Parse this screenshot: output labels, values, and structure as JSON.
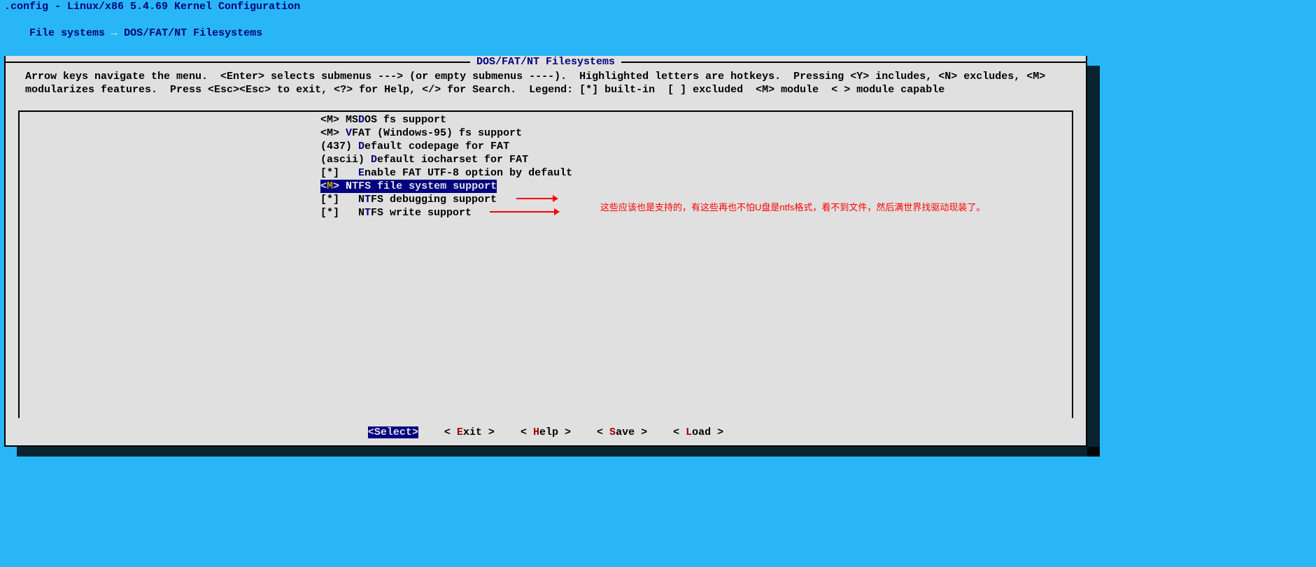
{
  "title": ".config - Linux/x86 5.4.69 Kernel Configuration",
  "breadcrumb": {
    "a": "File systems",
    "sep": " → ",
    "b": "DOS/FAT/NT Filesystems"
  },
  "panel_title": "DOS/FAT/NT Filesystems",
  "help_text": "Arrow keys navigate the menu.  <Enter> selects submenus ---> (or empty submenus ----).  Highlighted letters are hotkeys.  Pressing <Y> includes, <N> excludes, <M> modularizes features.  Press <Esc><Esc> to exit, <?> for Help, </> for Search.  Legend: [*] built-in  [ ] excluded  <M> module  < > module capable",
  "items": [
    {
      "prefix": "<M> MS",
      "hot": "D",
      "rest": "OS fs support",
      "selected": false,
      "indent": ""
    },
    {
      "prefix": "<M> ",
      "hot": "V",
      "rest": "FAT (Windows-95) fs support",
      "selected": false,
      "indent": ""
    },
    {
      "prefix": "(437) ",
      "hot": "D",
      "rest": "efault codepage for FAT",
      "selected": false,
      "indent": ""
    },
    {
      "prefix": "(ascii) ",
      "hot": "D",
      "rest": "efault iocharset for FAT",
      "selected": false,
      "indent": ""
    },
    {
      "prefix": "[*]   ",
      "hot": "E",
      "rest": "nable FAT UTF-8 option by default",
      "selected": false,
      "indent": ""
    },
    {
      "prefix": "<",
      "hot_inline": "M",
      "prefix2": "> ",
      "hot": "N",
      "rest": "TFS file system support",
      "selected": true,
      "indent": ""
    },
    {
      "prefix": "[*]   N",
      "hot": "T",
      "rest": "FS debugging support",
      "selected": false,
      "indent": ""
    },
    {
      "prefix": "[*]   N",
      "hot": "T",
      "rest": "FS write support",
      "selected": false,
      "indent": ""
    }
  ],
  "buttons": {
    "select": "Select",
    "exit": "xit",
    "exit_hot": "E",
    "help": "elp",
    "help_hot": "H",
    "save": "ave",
    "save_hot": "S",
    "load": "oad",
    "load_hot": "L"
  },
  "annotation": "这些应该也是支持的，有这些再也不怕U盘是ntfs格式，看不到文件，然后满世界找驱动现装了。"
}
